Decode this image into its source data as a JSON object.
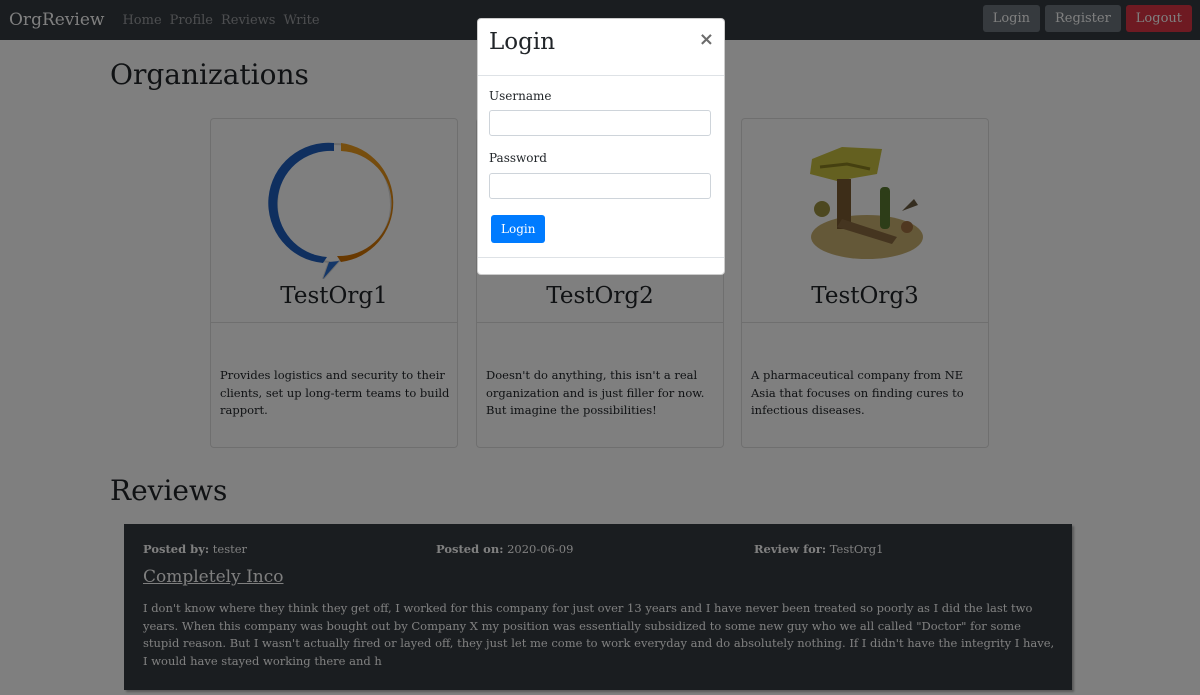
{
  "navbar": {
    "brand": "OrgReview",
    "links": [
      "Home",
      "Profile",
      "Reviews",
      "Write"
    ],
    "buttons": {
      "login": "Login",
      "register": "Register",
      "logout": "Logout"
    }
  },
  "organizations": {
    "heading": "Organizations",
    "cards": [
      {
        "name": "TestOrg1",
        "description": "Provides logistics and security to their clients, set up long-term teams to build rapport."
      },
      {
        "name": "TestOrg2",
        "description": "Doesn't do anything, this isn't a real organization and is just filler for now. But imagine the possibilities!"
      },
      {
        "name": "TestOrg3",
        "description": "A pharmaceutical company from NE Asia that focuses on finding cures to infectious diseases."
      }
    ]
  },
  "reviews": {
    "heading": "Reviews",
    "items": [
      {
        "posted_by_label": "Posted by:",
        "posted_by": "tester",
        "posted_on_label": "Posted on:",
        "posted_on": "2020-06-09",
        "review_for_label": "Review for:",
        "review_for": "TestOrg1",
        "title": "Completely Inco",
        "body": "I don't know where they think they get off, I worked for this company for just over 13 years and I have never been treated so poorly as I did the last two years. When this company was bought out by Company X my position was essentially subsidized to some new guy who we all called \"Doctor\" for some stupid reason. But I wasn't actually fired or layed off, they just let me come to work everyday and do absolutely nothing. If I didn't have the integrity I have, I would have stayed working there and h"
      }
    ]
  },
  "login_modal": {
    "title": "Login",
    "close": "×",
    "username_label": "Username",
    "username_value": "",
    "password_label": "Password",
    "password_value": "",
    "submit": "Login"
  },
  "colors": {
    "navbar": "#343a40",
    "primary": "#007bff",
    "danger": "#dc3545",
    "secondary": "#6c757d"
  }
}
